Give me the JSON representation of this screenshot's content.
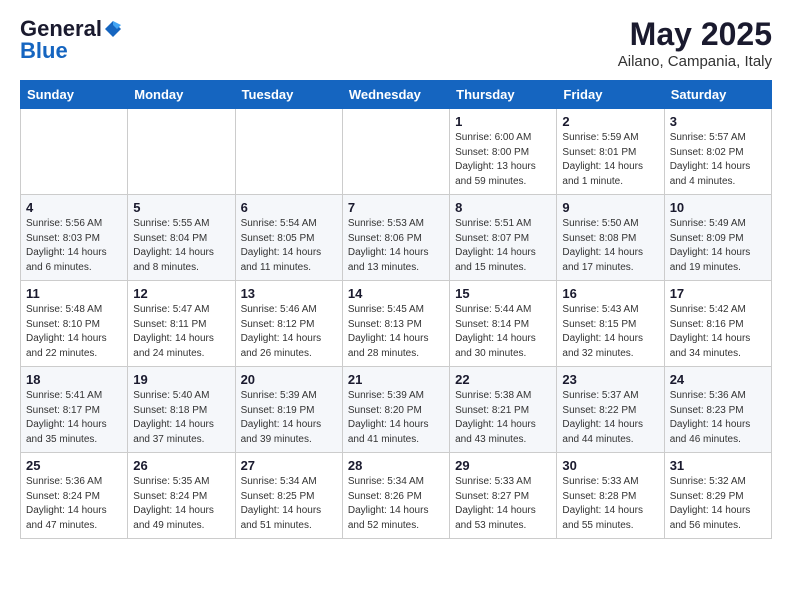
{
  "header": {
    "logo_general": "General",
    "logo_blue": "Blue",
    "main_title": "May 2025",
    "subtitle": "Ailano, Campania, Italy"
  },
  "weekdays": [
    "Sunday",
    "Monday",
    "Tuesday",
    "Wednesday",
    "Thursday",
    "Friday",
    "Saturday"
  ],
  "weeks": [
    [
      {
        "day": "",
        "info": ""
      },
      {
        "day": "",
        "info": ""
      },
      {
        "day": "",
        "info": ""
      },
      {
        "day": "",
        "info": ""
      },
      {
        "day": "1",
        "info": "Sunrise: 6:00 AM\nSunset: 8:00 PM\nDaylight: 13 hours\nand 59 minutes."
      },
      {
        "day": "2",
        "info": "Sunrise: 5:59 AM\nSunset: 8:01 PM\nDaylight: 14 hours\nand 1 minute."
      },
      {
        "day": "3",
        "info": "Sunrise: 5:57 AM\nSunset: 8:02 PM\nDaylight: 14 hours\nand 4 minutes."
      }
    ],
    [
      {
        "day": "4",
        "info": "Sunrise: 5:56 AM\nSunset: 8:03 PM\nDaylight: 14 hours\nand 6 minutes."
      },
      {
        "day": "5",
        "info": "Sunrise: 5:55 AM\nSunset: 8:04 PM\nDaylight: 14 hours\nand 8 minutes."
      },
      {
        "day": "6",
        "info": "Sunrise: 5:54 AM\nSunset: 8:05 PM\nDaylight: 14 hours\nand 11 minutes."
      },
      {
        "day": "7",
        "info": "Sunrise: 5:53 AM\nSunset: 8:06 PM\nDaylight: 14 hours\nand 13 minutes."
      },
      {
        "day": "8",
        "info": "Sunrise: 5:51 AM\nSunset: 8:07 PM\nDaylight: 14 hours\nand 15 minutes."
      },
      {
        "day": "9",
        "info": "Sunrise: 5:50 AM\nSunset: 8:08 PM\nDaylight: 14 hours\nand 17 minutes."
      },
      {
        "day": "10",
        "info": "Sunrise: 5:49 AM\nSunset: 8:09 PM\nDaylight: 14 hours\nand 19 minutes."
      }
    ],
    [
      {
        "day": "11",
        "info": "Sunrise: 5:48 AM\nSunset: 8:10 PM\nDaylight: 14 hours\nand 22 minutes."
      },
      {
        "day": "12",
        "info": "Sunrise: 5:47 AM\nSunset: 8:11 PM\nDaylight: 14 hours\nand 24 minutes."
      },
      {
        "day": "13",
        "info": "Sunrise: 5:46 AM\nSunset: 8:12 PM\nDaylight: 14 hours\nand 26 minutes."
      },
      {
        "day": "14",
        "info": "Sunrise: 5:45 AM\nSunset: 8:13 PM\nDaylight: 14 hours\nand 28 minutes."
      },
      {
        "day": "15",
        "info": "Sunrise: 5:44 AM\nSunset: 8:14 PM\nDaylight: 14 hours\nand 30 minutes."
      },
      {
        "day": "16",
        "info": "Sunrise: 5:43 AM\nSunset: 8:15 PM\nDaylight: 14 hours\nand 32 minutes."
      },
      {
        "day": "17",
        "info": "Sunrise: 5:42 AM\nSunset: 8:16 PM\nDaylight: 14 hours\nand 34 minutes."
      }
    ],
    [
      {
        "day": "18",
        "info": "Sunrise: 5:41 AM\nSunset: 8:17 PM\nDaylight: 14 hours\nand 35 minutes."
      },
      {
        "day": "19",
        "info": "Sunrise: 5:40 AM\nSunset: 8:18 PM\nDaylight: 14 hours\nand 37 minutes."
      },
      {
        "day": "20",
        "info": "Sunrise: 5:39 AM\nSunset: 8:19 PM\nDaylight: 14 hours\nand 39 minutes."
      },
      {
        "day": "21",
        "info": "Sunrise: 5:39 AM\nSunset: 8:20 PM\nDaylight: 14 hours\nand 41 minutes."
      },
      {
        "day": "22",
        "info": "Sunrise: 5:38 AM\nSunset: 8:21 PM\nDaylight: 14 hours\nand 43 minutes."
      },
      {
        "day": "23",
        "info": "Sunrise: 5:37 AM\nSunset: 8:22 PM\nDaylight: 14 hours\nand 44 minutes."
      },
      {
        "day": "24",
        "info": "Sunrise: 5:36 AM\nSunset: 8:23 PM\nDaylight: 14 hours\nand 46 minutes."
      }
    ],
    [
      {
        "day": "25",
        "info": "Sunrise: 5:36 AM\nSunset: 8:24 PM\nDaylight: 14 hours\nand 47 minutes."
      },
      {
        "day": "26",
        "info": "Sunrise: 5:35 AM\nSunset: 8:24 PM\nDaylight: 14 hours\nand 49 minutes."
      },
      {
        "day": "27",
        "info": "Sunrise: 5:34 AM\nSunset: 8:25 PM\nDaylight: 14 hours\nand 51 minutes."
      },
      {
        "day": "28",
        "info": "Sunrise: 5:34 AM\nSunset: 8:26 PM\nDaylight: 14 hours\nand 52 minutes."
      },
      {
        "day": "29",
        "info": "Sunrise: 5:33 AM\nSunset: 8:27 PM\nDaylight: 14 hours\nand 53 minutes."
      },
      {
        "day": "30",
        "info": "Sunrise: 5:33 AM\nSunset: 8:28 PM\nDaylight: 14 hours\nand 55 minutes."
      },
      {
        "day": "31",
        "info": "Sunrise: 5:32 AM\nSunset: 8:29 PM\nDaylight: 14 hours\nand 56 minutes."
      }
    ]
  ]
}
